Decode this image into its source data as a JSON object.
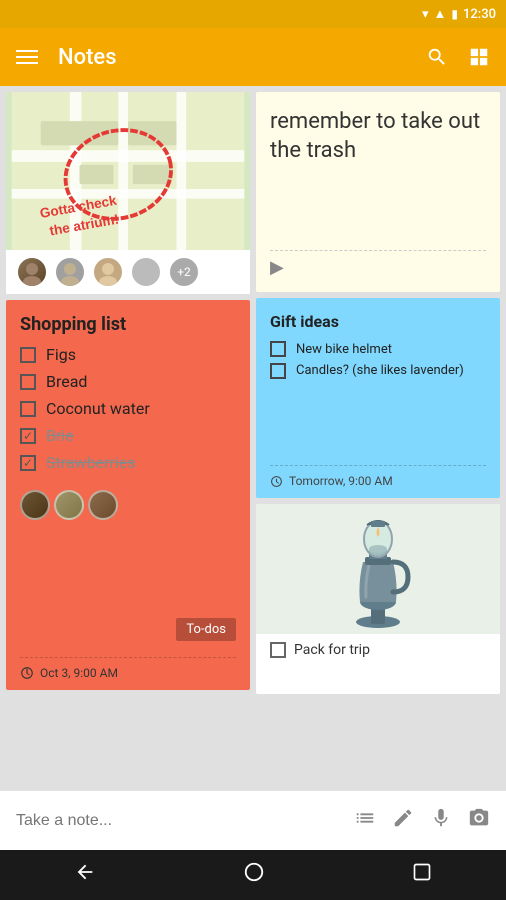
{
  "status_bar": {
    "time": "12:30"
  },
  "app_bar": {
    "menu_icon": "☰",
    "title": "Notes",
    "search_icon": "🔍",
    "grid_icon": "⊞"
  },
  "notes": {
    "map_note": {
      "annotation": "Gotta check the atrium!",
      "more_count": "+2"
    },
    "yellow_note": {
      "text": "remember to take out the trash"
    },
    "shopping_list": {
      "title": "Shopping list",
      "items": [
        {
          "text": "Figs",
          "checked": false,
          "strikethrough": false
        },
        {
          "text": "Bread",
          "checked": false,
          "strikethrough": false
        },
        {
          "text": "Coconut water",
          "checked": false,
          "strikethrough": false
        },
        {
          "text": "Brie",
          "checked": true,
          "strikethrough": true
        },
        {
          "text": "Strawberries",
          "checked": true,
          "strikethrough": true
        }
      ],
      "badge": "To-dos",
      "date": "Oct 3, 9:00 AM"
    },
    "gift_ideas": {
      "title": "Gift ideas",
      "items": [
        {
          "text": "New bike helmet",
          "checked": false
        },
        {
          "text": "Candles? (she likes lavender)",
          "checked": false
        }
      ],
      "reminder": "Tomorrow, 9:00 AM"
    },
    "lamp_note": {
      "item": "Pack for trip"
    }
  },
  "bottom_bar": {
    "placeholder": "Take a note...",
    "list_icon": "≡",
    "pencil_icon": "✏",
    "mic_icon": "🎤",
    "camera_icon": "📷"
  },
  "nav_bar": {
    "back_icon": "◀",
    "home_icon": "○",
    "recent_icon": "□"
  }
}
